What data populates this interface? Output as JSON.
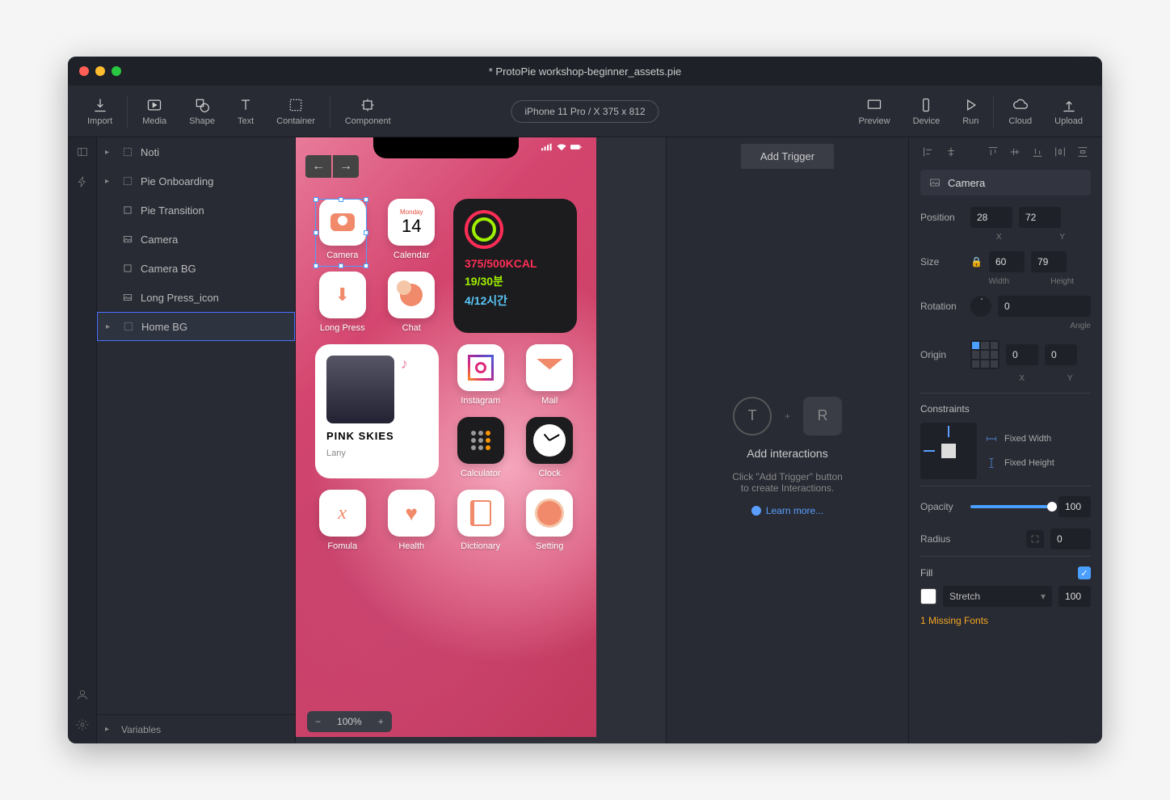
{
  "window": {
    "title": "* ProtoPie workshop-beginner_assets.pie"
  },
  "toolbar": {
    "import": "Import",
    "media": "Media",
    "shape": "Shape",
    "text": "Text",
    "container": "Container",
    "component": "Component",
    "device_label": "iPhone 11 Pro / X  375 x 812",
    "preview": "Preview",
    "device": "Device",
    "run": "Run",
    "cloud": "Cloud",
    "upload": "Upload"
  },
  "layers": {
    "items": [
      {
        "label": "Noti",
        "caret": true
      },
      {
        "label": "Pie Onboarding",
        "caret": true
      },
      {
        "label": "Pie Transition",
        "caret": false
      },
      {
        "label": "Camera",
        "caret": false
      },
      {
        "label": "Camera BG",
        "caret": false
      },
      {
        "label": "Long Press_icon",
        "caret": false
      },
      {
        "label": "Home BG",
        "caret": true,
        "selected": true
      }
    ],
    "variables": "Variables"
  },
  "canvas": {
    "zoom": "100%",
    "calendar_day": "Monday",
    "calendar_date": "14",
    "apps": {
      "camera": "Camera",
      "calendar": "Calendar",
      "longpress": "Long Press",
      "chat": "Chat",
      "instagram": "Instagram",
      "mail": "Mail",
      "calculator": "Calculator",
      "clock": "Clock",
      "formula": "Fomula",
      "health": "Health",
      "dictionary": "Dictionary",
      "setting": "Setting"
    },
    "widget": {
      "kcal": "375/500KCAL",
      "mins": "19/30분",
      "hours": "4/12시간"
    },
    "music": {
      "title": "PINK SKIES",
      "artist": "Lany"
    }
  },
  "interactions": {
    "add_trigger": "Add Trigger",
    "title": "Add interactions",
    "line1": "Click \"Add Trigger\" button",
    "line2": "to create Interactions.",
    "learn": "Learn more..."
  },
  "inspector": {
    "name": "Camera",
    "position": {
      "label": "Position",
      "x": "28",
      "y": "72",
      "xl": "X",
      "yl": "Y"
    },
    "size": {
      "label": "Size",
      "w": "60",
      "h": "79",
      "wl": "Width",
      "hl": "Height"
    },
    "rotation": {
      "label": "Rotation",
      "v": "0",
      "sub": "Angle"
    },
    "origin": {
      "label": "Origin",
      "x": "0",
      "y": "0",
      "xl": "X",
      "yl": "Y"
    },
    "constraints": {
      "label": "Constraints",
      "fw": "Fixed Width",
      "fh": "Fixed Height"
    },
    "opacity": {
      "label": "Opacity",
      "v": "100"
    },
    "radius": {
      "label": "Radius",
      "v": "0"
    },
    "fill": {
      "label": "Fill",
      "mode": "Stretch",
      "v": "100"
    },
    "warn": "1 Missing Fonts"
  }
}
